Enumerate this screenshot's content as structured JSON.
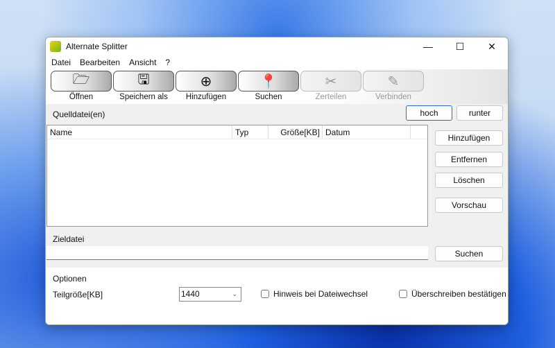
{
  "window": {
    "title": "Alternate Splitter",
    "minimize": "—",
    "maximize": "☐",
    "close": "✕"
  },
  "menu": [
    "Datei",
    "Bearbeiten",
    "Ansicht",
    "?"
  ],
  "toolbar": [
    {
      "label": "Öffnen",
      "icon": "folder-open-icon",
      "glyph": "🗁",
      "enabled": true
    },
    {
      "label": "Speichern als",
      "icon": "floppy-disk-icon",
      "glyph": "🖫",
      "enabled": true
    },
    {
      "label": "Hinzufügen",
      "icon": "plus-circle-icon",
      "glyph": "⊕",
      "enabled": true
    },
    {
      "label": "Suchen",
      "icon": "map-pin-icon",
      "glyph": "📍",
      "enabled": true
    },
    {
      "label": "Zerteilen",
      "icon": "scissors-icon",
      "glyph": "✂",
      "enabled": false
    },
    {
      "label": "Verbinden",
      "icon": "glue-icon",
      "glyph": "✎",
      "enabled": false
    }
  ],
  "source": {
    "label": "Quelldatei(en)",
    "up": "hoch",
    "down": "runter",
    "columns": [
      "Name",
      "Typ",
      "Größe[KB]",
      "Datum"
    ],
    "buttons": [
      "Hinzufügen",
      "Entfernen",
      "Löschen",
      "Vorschau"
    ]
  },
  "target": {
    "label": "Zieldatei",
    "value": "",
    "search": "Suchen"
  },
  "options": {
    "label": "Optionen",
    "part_size_label": "Teilgröße[KB]",
    "part_size": "1440",
    "notify": "Hinweis bei Dateiwechsel",
    "notify_checked": false,
    "overwrite": "Überschreiben bestätigen",
    "overwrite_checked": false
  }
}
